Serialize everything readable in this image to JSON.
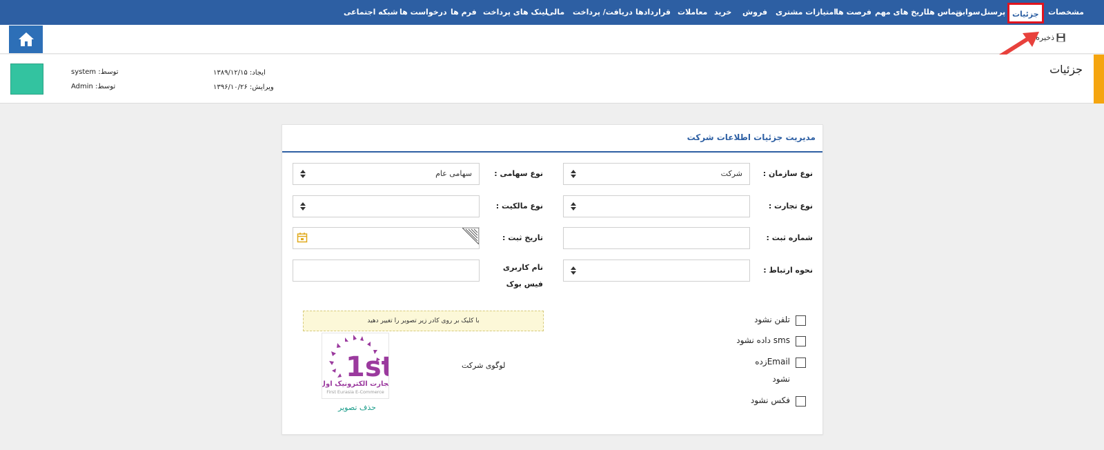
{
  "nav": {
    "items": [
      {
        "label": "مشخصات"
      },
      {
        "label": "جزئیات",
        "active": true
      },
      {
        "label": "پرسنل"
      },
      {
        "label": "سوابق"
      },
      {
        "label": "تماس ها"
      },
      {
        "label": "تاریخ های مهم"
      },
      {
        "label": "فرصت ها"
      },
      {
        "label": "امتیازات مشتری"
      },
      {
        "label": "فروش"
      },
      {
        "label": "خرید"
      },
      {
        "label": "معاملات"
      },
      {
        "label": "قراردادها"
      },
      {
        "label": "دریافت/ پرداخت"
      },
      {
        "label": "مالی"
      },
      {
        "label": "لینک های پرداخت"
      },
      {
        "label": "فرم ها"
      },
      {
        "label": "درخواست ها"
      },
      {
        "label": "شبکه اجتماعی"
      }
    ]
  },
  "toolbar": {
    "save_label": "ذخیره",
    "home_icon": "home-icon",
    "save_icon": "floppy-disk-icon"
  },
  "header": {
    "title": "جزئیات",
    "created_label": "ایجاد:",
    "created_date": "۱۳۸۹/۱۲/۱۵",
    "edited_label": "ویرایش:",
    "edited_date": "۱۳۹۶/۱۰/۲۶",
    "by_label": "توسط:",
    "created_by": "system",
    "edited_by": "Admin",
    "swatch_color": "#33c3a0"
  },
  "card": {
    "title": "مدیریت جزئیات اطلاعات شرکت"
  },
  "form": {
    "org_type_label": "نوع سازمان :",
    "org_type_value": "شرکت",
    "share_type_label": "نوع سهامی :",
    "share_type_value": "سهامی عام",
    "trade_type_label": "نوع تجارت :",
    "trade_type_value": "",
    "ownership_type_label": "نوع مالکیت :",
    "ownership_type_value": "",
    "reg_number_label": "شماره ثبت :",
    "reg_number_value": "",
    "reg_date_label": "تاریخ ثبت :",
    "reg_date_value": "",
    "contact_method_label": "نحوه ارتباط :",
    "contact_method_value": "",
    "facebook_label": "نام کاربری فیس بوک",
    "facebook_value": ""
  },
  "checkboxes": [
    {
      "label": "تلفن نشود",
      "checked": false
    },
    {
      "label": "sms داده نشود",
      "checked": false
    },
    {
      "label": "Emailزده نشود",
      "checked": false
    },
    {
      "label": "فکس نشود",
      "checked": false
    }
  ],
  "logo": {
    "notice": "با کلیک بر روی کادر زیر تصویر را تغییر دهید",
    "label": "لوگوی شرکت",
    "delete_label": "حذف تصویر",
    "brand_mark": "1st",
    "brand_text_fa": "تجارت الکترونیک اول",
    "brand_text_en": "First Eurasia E-Commerce",
    "brand_color": "#9b3a9e"
  },
  "colors": {
    "nav_bg": "#2d5fa3",
    "accent": "#f5a50f",
    "highlight": "#e0141e"
  }
}
